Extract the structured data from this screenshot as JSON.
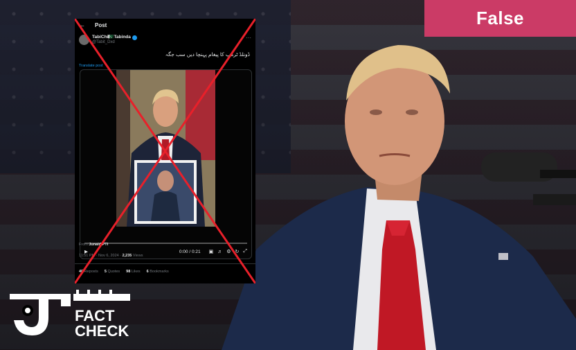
{
  "verdict": {
    "label": "False",
    "color": "#cb3b66"
  },
  "tweet": {
    "header_title": "Post",
    "user_name": "TabiChi🇵🇰Tabinda",
    "handle": "@Tabit_Dxd",
    "text": "ڈونلڈ ٹرمپ کا پیغام پہنچا دیں سب جگہ",
    "translate_label": "Translate post",
    "video_time": "0:00 / 0:21",
    "from_prefix": "From",
    "from_source": "Junaid PTI",
    "timestamp": "11:51 PM · Nov 6, 2024",
    "views_count": "2,235",
    "views_label": "Views",
    "reposts_count": "40",
    "reposts_label": "Reposts",
    "quotes_count": "5",
    "quotes_label": "Quotes",
    "likes_count": "98",
    "likes_label": "Likes",
    "bookmarks_count": "6",
    "bookmarks_label": "Bookmarks"
  },
  "logo": {
    "line1": "FACT",
    "line2": "CHECK"
  },
  "icons": {
    "back": "arrow-left-icon",
    "more": "more-icon",
    "play": "play-icon",
    "cross": "red-x-mark-icon"
  }
}
